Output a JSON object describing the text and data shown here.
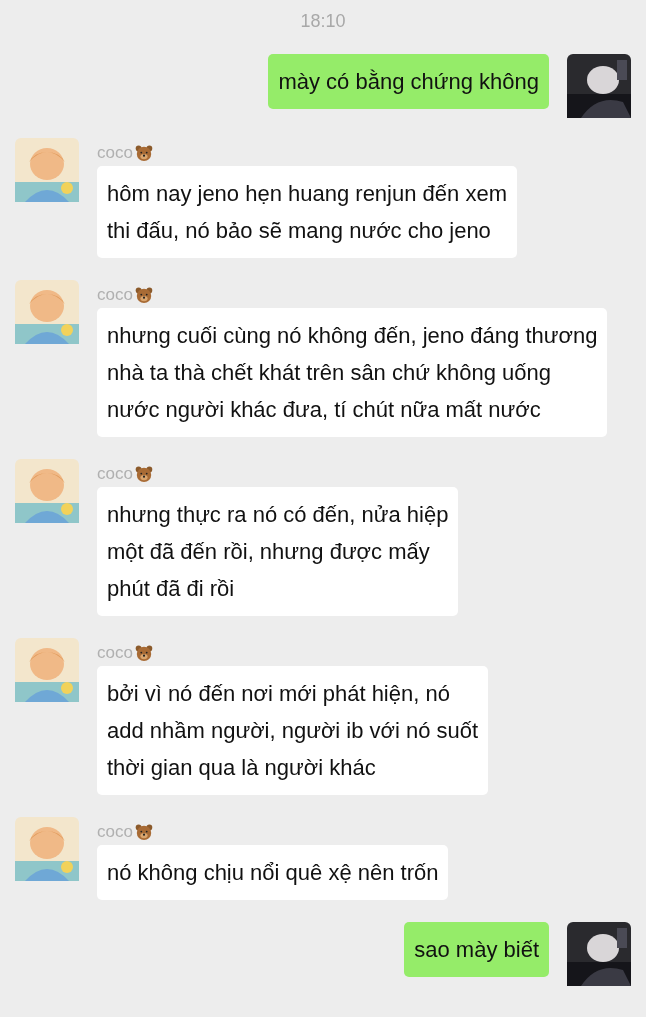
{
  "time": "18:10",
  "messages": [
    {
      "kind": "sent",
      "text": "mày có bằng chứng không"
    },
    {
      "kind": "received",
      "sender": "coco",
      "text": "hôm nay jeno hẹn huang renjun đến xem\nthi đấu, nó bảo sẽ mang nước cho jeno"
    },
    {
      "kind": "received",
      "sender": "coco",
      "text": "nhưng cuối cùng nó không đến, jeno đáng thương\nnhà ta thà chết khát trên sân chứ không uống\nnước người khác đưa, tí chút nữa mất nước"
    },
    {
      "kind": "received",
      "sender": "coco",
      "text": "nhưng thực ra nó có đến, nửa hiệp\nmột đã đến rồi, nhưng được mấy\nphút đã đi rồi"
    },
    {
      "kind": "received",
      "sender": "coco",
      "text": "bởi vì nó đến nơi mới phát hiện, nó\nadd nhầm người, người ib với nó suốt\nthời gian qua là người khác"
    },
    {
      "kind": "received",
      "sender": "coco",
      "text": "nó không chịu nổi quê xệ nên trốn\n "
    },
    {
      "kind": "sent",
      "text": "sao mày biết"
    }
  ]
}
